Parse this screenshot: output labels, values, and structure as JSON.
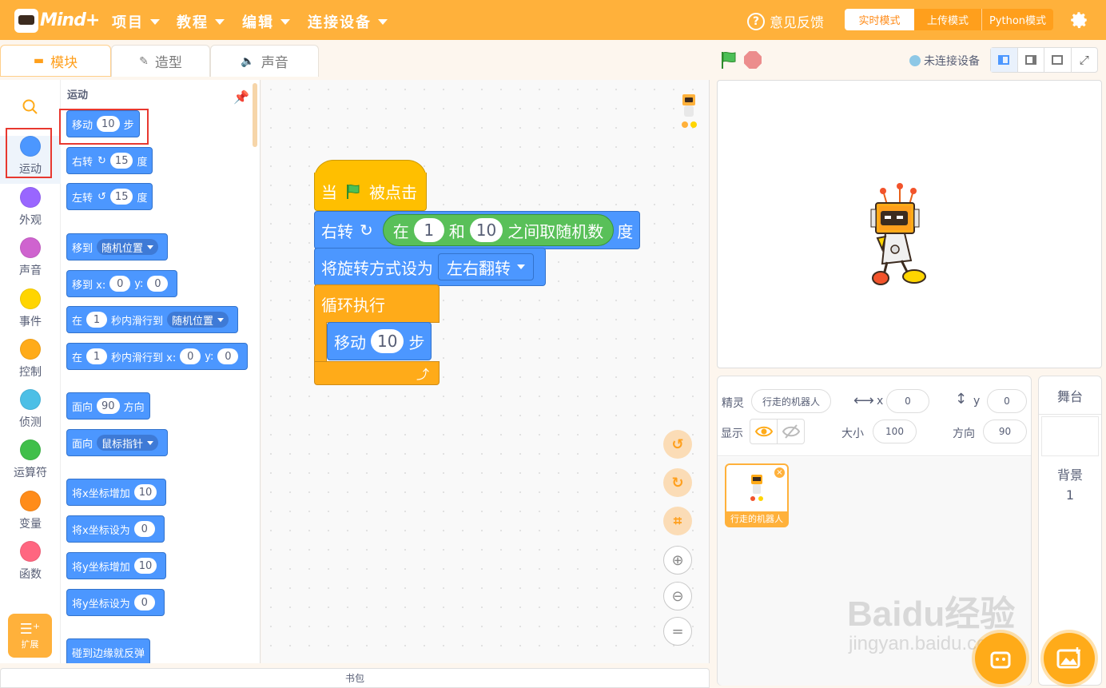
{
  "app": {
    "logo_text": "Mind+"
  },
  "menu": [
    {
      "label": "项目"
    },
    {
      "label": "教程"
    },
    {
      "label": "编辑"
    },
    {
      "label": "连接设备"
    }
  ],
  "header": {
    "feedback_label": "意见反馈",
    "modes": {
      "live": "实时模式",
      "upload": "上传模式",
      "python": "Python模式"
    }
  },
  "tabs": {
    "blocks": "模块",
    "costumes": "造型",
    "sounds": "声音"
  },
  "categories": [
    {
      "label": "运动",
      "color": "#4c97ff"
    },
    {
      "label": "外观",
      "color": "#9966ff"
    },
    {
      "label": "声音",
      "color": "#cf63cf"
    },
    {
      "label": "事件",
      "color": "#ffd500"
    },
    {
      "label": "控制",
      "color": "#ffab19"
    },
    {
      "label": "侦测",
      "color": "#4cbfe6"
    },
    {
      "label": "运算符",
      "color": "#40bf4a"
    },
    {
      "label": "变量",
      "color": "#ff8c1a"
    },
    {
      "label": "函数",
      "color": "#ff6680"
    }
  ],
  "extension_label": "扩展",
  "palette": {
    "title": "运动",
    "move": {
      "pre": "移动",
      "value": "10",
      "post": "步"
    },
    "turn_right": {
      "pre": "右转",
      "value": "15",
      "post": "度"
    },
    "turn_left": {
      "pre": "左转",
      "value": "15",
      "post": "度"
    },
    "goto": {
      "pre": "移到",
      "option": "随机位置"
    },
    "goto_xy": {
      "pre": "移到 x:",
      "x": "0",
      "ylabel": "y:",
      "y": "0"
    },
    "glide": {
      "pre": "在",
      "value": "1",
      "mid": "秒内滑行到",
      "option": "随机位置"
    },
    "glide_xy": {
      "pre": "在",
      "value": "1",
      "mid": "秒内滑行到 x:",
      "x": "0",
      "ylabel": "y:",
      "y": "0"
    },
    "point_dir": {
      "pre": "面向",
      "value": "90",
      "post": "方向"
    },
    "point_towards": {
      "pre": "面向",
      "option": "鼠标指针"
    },
    "change_x": {
      "pre": "将x坐标增加",
      "value": "10"
    },
    "set_x": {
      "pre": "将x坐标设为",
      "value": "0"
    },
    "change_y": {
      "pre": "将y坐标增加",
      "value": "10"
    },
    "set_y": {
      "pre": "将y坐标设为",
      "value": "0"
    },
    "bounce": "碰到边缘就反弹"
  },
  "script": {
    "hat": {
      "pre": "当",
      "post": "被点击"
    },
    "turn": {
      "pre": "右转",
      "op_pre": "在",
      "a": "1",
      "op_mid": "和",
      "b": "10",
      "op_post": "之间取随机数",
      "post": "度"
    },
    "rotation": {
      "pre": "将旋转方式设为",
      "option": "左右翻转"
    },
    "forever": "循环执行",
    "move": {
      "pre": "移动",
      "value": "10",
      "post": "步"
    }
  },
  "stage": {
    "connection": "未连接设备"
  },
  "sprite": {
    "label": "精灵",
    "name": "行走的机器人",
    "x_label": "x",
    "x": "0",
    "y_label": "y",
    "y": "0",
    "show_label": "显示",
    "size_label": "大小",
    "size": "100",
    "direction_label": "方向",
    "direction": "90",
    "thumb_name": "行走的机器人"
  },
  "stage_panel": {
    "title": "舞台",
    "backdrop_label": "背景",
    "backdrop_count": "1"
  },
  "backpack": "书包",
  "watermark": {
    "big": "Baidu经验",
    "small": "jingyan.baidu.com"
  },
  "colors": {
    "accent": "#ffb13b",
    "motion": "#4c97ff",
    "event": "#ffbf00",
    "control": "#ffab19",
    "operator": "#59c059"
  }
}
